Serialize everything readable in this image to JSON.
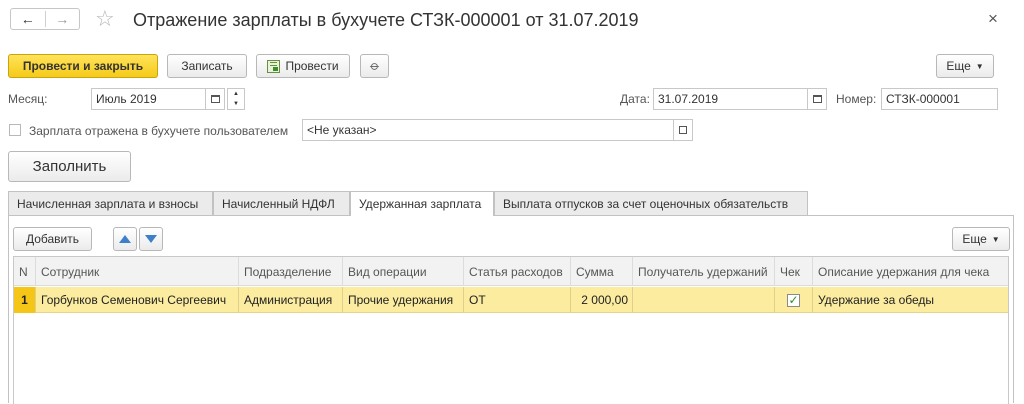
{
  "window": {
    "title": "Отражение зарплаты в бухучете СТЗК-000001 от 31.07.2019",
    "back_glyph": "←",
    "forward_glyph": "→",
    "star_glyph": "☆",
    "close_glyph": "×"
  },
  "toolbar": {
    "post_and_close": "Провести и закрыть",
    "save": "Записать",
    "post": "Провести",
    "more": "Еще"
  },
  "fields": {
    "month_label": "Месяц:",
    "month_value": "Июль 2019",
    "date_label": "Дата:",
    "date_value": "31.07.2019",
    "number_label": "Номер:",
    "number_value": "СТЗК-000001",
    "reflected_label": "Зарплата отражена в бухучете пользователем",
    "user_value": "<Не указан>"
  },
  "fill_button": "Заполнить",
  "tabs": [
    {
      "label": "Начисленная зарплата и взносы",
      "active": false
    },
    {
      "label": "Начисленный НДФЛ",
      "active": false
    },
    {
      "label": "Удержанная зарплата",
      "active": true
    },
    {
      "label": "Выплата отпусков за счет оценочных обязательств",
      "active": false
    }
  ],
  "table_toolbar": {
    "add": "Добавить",
    "more": "Еще"
  },
  "table": {
    "columns": [
      "N",
      "Сотрудник",
      "Подразделение",
      "Вид операции",
      "Статья расходов",
      "Сумма",
      "Получатель удержаний",
      "Чек",
      "Описание удержания для чека"
    ],
    "rows": [
      {
        "n": "1",
        "employee": "Горбунков Семенович Сергеевич",
        "department": "Администрация",
        "operation": "Прочие удержания",
        "expense_item": "ОТ",
        "amount": "2 000,00",
        "recipient": "",
        "check": true,
        "description": "Удержание за обеды"
      }
    ]
  },
  "colors": {
    "accent_yellow": "#f5ca1a",
    "selected_row": "#fbeca0",
    "arrow_blue": "#3d7fc9",
    "check_green": "#2e8b2e"
  }
}
